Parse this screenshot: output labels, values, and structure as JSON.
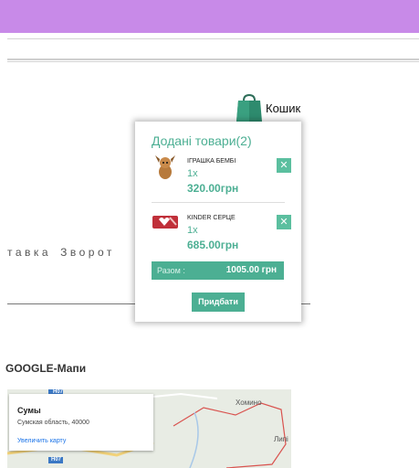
{
  "header": {
    "color": "#c88ae8"
  },
  "cart": {
    "label": "Кошик",
    "icon": "shopping-bag-icon"
  },
  "nav": {
    "items": [
      "тавка",
      "Зворот"
    ]
  },
  "popup": {
    "title": "Додані товари(2)",
    "items": [
      {
        "name": "ІГРАШКА БЕМБІ",
        "qty": "1x",
        "price": "320.00грн",
        "remove": "✕"
      },
      {
        "name": "KINDER СЕРЦЕ",
        "qty": "1x",
        "price": "685.00грн",
        "remove": "✕"
      }
    ],
    "total": {
      "label": "Разом :",
      "value": "1005.00 грн"
    },
    "checkout_label": "Придбати",
    "accent": "#4caf93"
  },
  "map": {
    "title": "GOOGLE-Мапи",
    "city": "Сумы",
    "address": "Сумская область, 40000",
    "enlarge": "Увеличить карту",
    "places": [
      "Хомино",
      "Липі"
    ],
    "roads": [
      "H07",
      "H07"
    ]
  }
}
